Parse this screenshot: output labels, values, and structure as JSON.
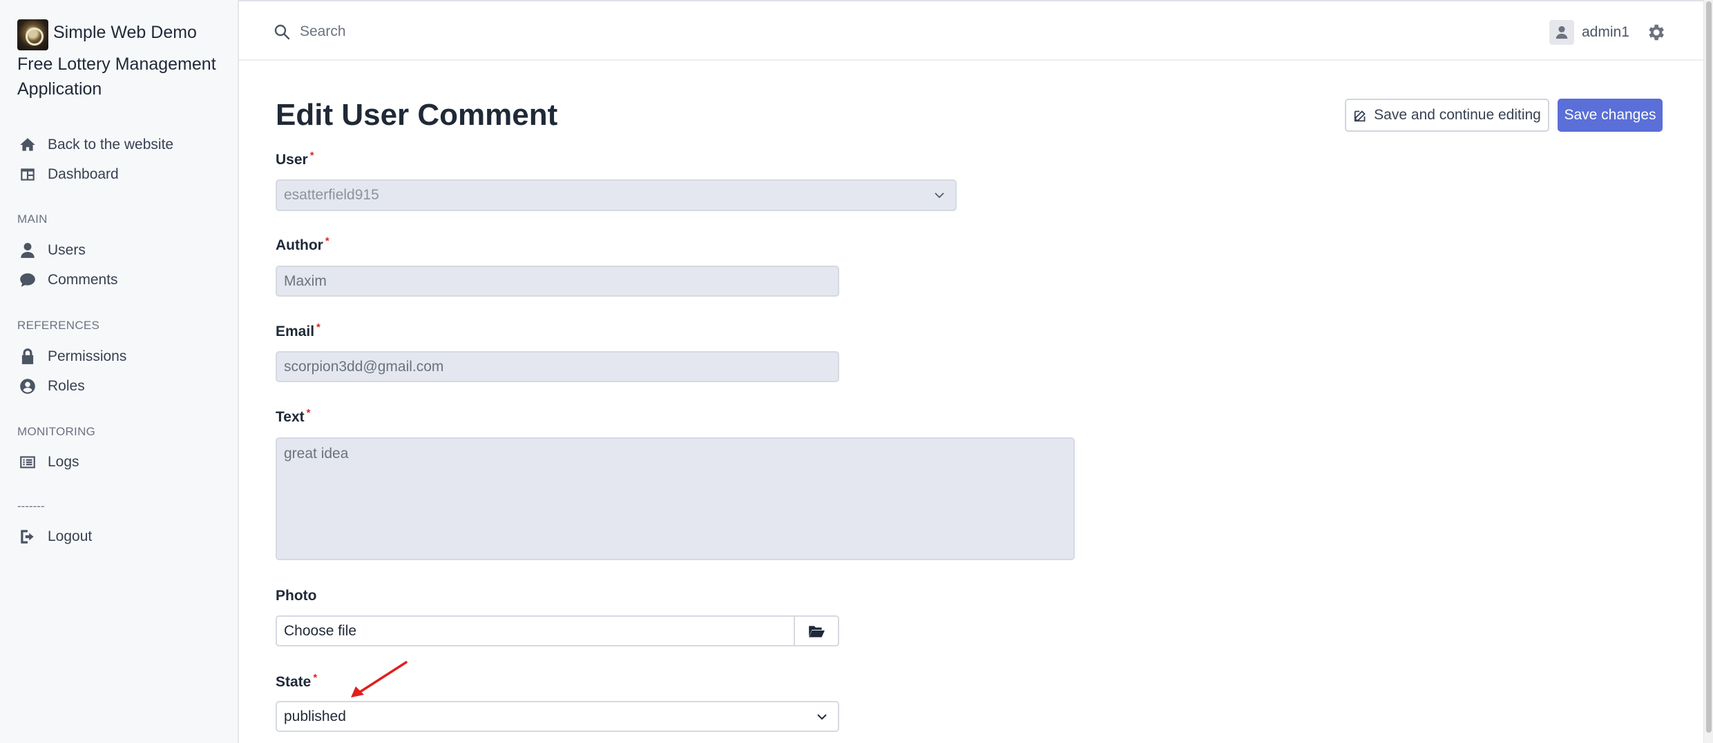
{
  "brand": {
    "title": "Simple Web Demo",
    "subtitle": "Free Lottery Management Application"
  },
  "sidebar": {
    "top_items": [
      {
        "label": "Back to the website",
        "icon": "home-icon"
      },
      {
        "label": "Dashboard",
        "icon": "dashboard-icon"
      }
    ],
    "sections": [
      {
        "title": "MAIN",
        "items": [
          {
            "label": "Users",
            "icon": "user-icon"
          },
          {
            "label": "Comments",
            "icon": "comment-icon"
          }
        ]
      },
      {
        "title": "REFERENCES",
        "items": [
          {
            "label": "Permissions",
            "icon": "lock-icon"
          },
          {
            "label": "Roles",
            "icon": "user-circle-icon"
          }
        ]
      },
      {
        "title": "MONITORING",
        "items": [
          {
            "label": "Logs",
            "icon": "list-icon"
          }
        ]
      }
    ],
    "separator": "-------",
    "logout": {
      "label": "Logout",
      "icon": "logout-icon"
    }
  },
  "topbar": {
    "search_placeholder": "Search",
    "username": "admin1"
  },
  "page": {
    "title": "Edit User Comment",
    "save_continue_label": "Save and continue editing",
    "save_label": "Save changes"
  },
  "form": {
    "user": {
      "label": "User",
      "value": "esatterfield915"
    },
    "author": {
      "label": "Author",
      "value": "Maxim"
    },
    "email": {
      "label": "Email",
      "value": "scorpion3dd@gmail.com"
    },
    "text": {
      "label": "Text",
      "value": "great idea"
    },
    "photo": {
      "label": "Photo",
      "value": "Choose file"
    },
    "state": {
      "label": "State",
      "value": "published"
    },
    "required_mark": "*"
  },
  "colors": {
    "primary": "#5a6fd8",
    "required": "#e02424",
    "annotation_arrow": "#e0201c"
  }
}
